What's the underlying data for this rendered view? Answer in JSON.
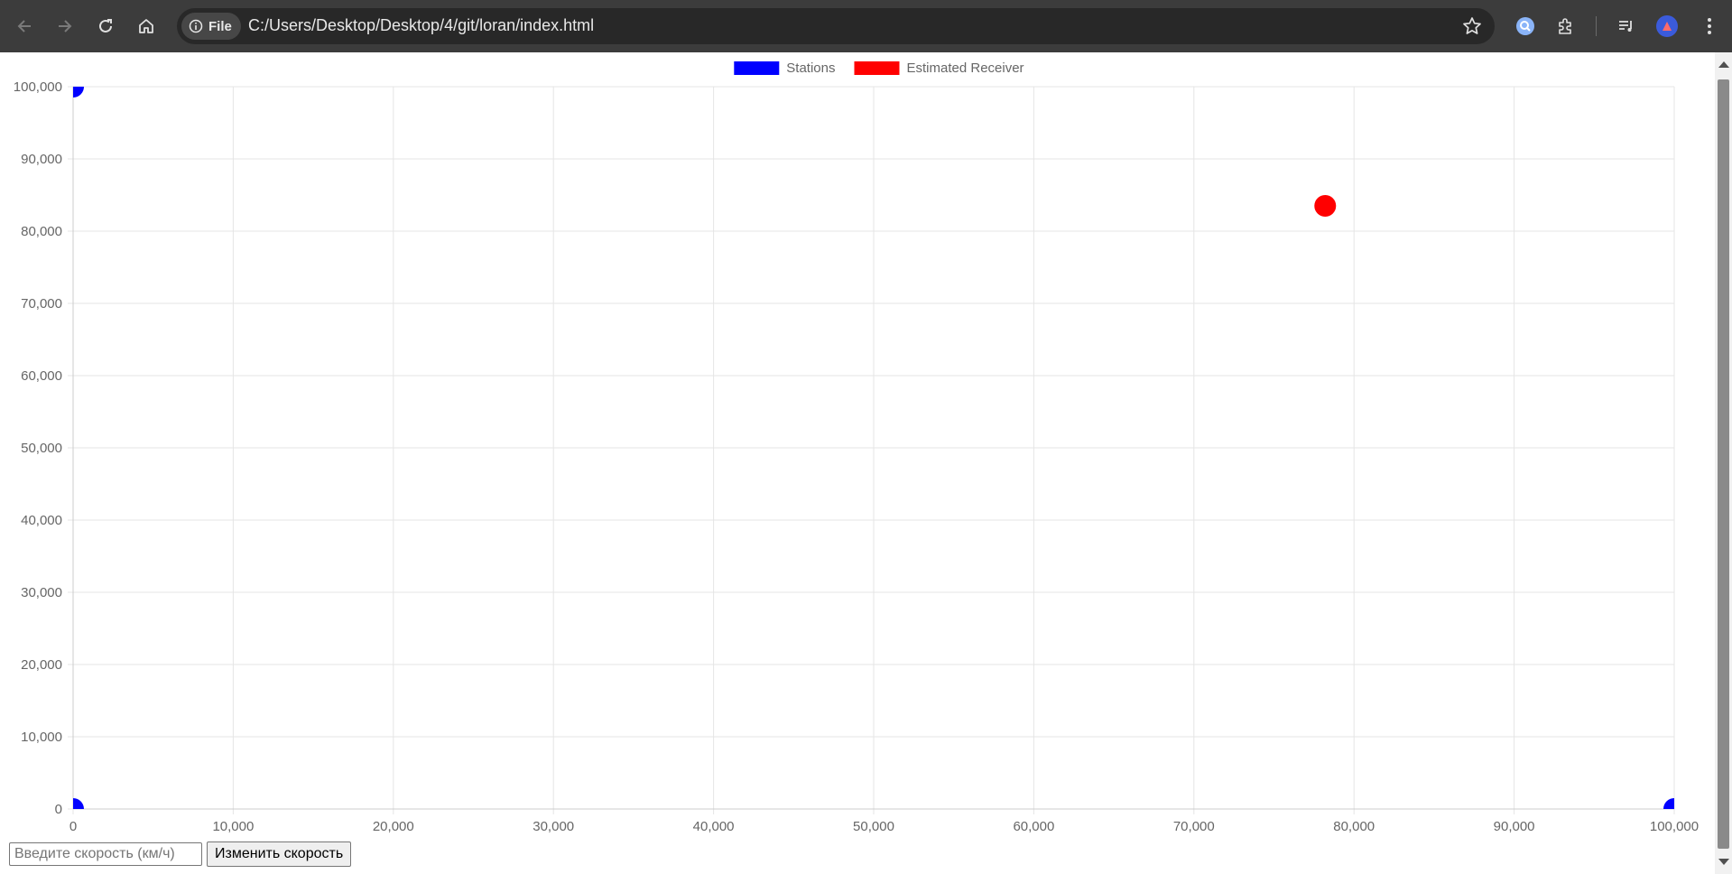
{
  "browser": {
    "scheme_chip": "File",
    "url": "C:/Users/Desktop/Desktop/4/git/loran/index.html"
  },
  "chart_data": {
    "type": "scatter",
    "xlim": [
      0,
      100000
    ],
    "ylim": [
      0,
      100000
    ],
    "x_ticks": [
      "0",
      "10,000",
      "20,000",
      "30,000",
      "40,000",
      "50,000",
      "60,000",
      "70,000",
      "80,000",
      "90,000",
      "100,000"
    ],
    "y_ticks": [
      "0",
      "10,000",
      "20,000",
      "30,000",
      "40,000",
      "50,000",
      "60,000",
      "70,000",
      "80,000",
      "90,000",
      "100,000"
    ],
    "grid": true,
    "legend_position": "top-center",
    "series": [
      {
        "name": "Stations",
        "color": "#0000ff",
        "points": [
          [
            0,
            0
          ],
          [
            100000,
            0
          ],
          [
            0,
            100000
          ]
        ]
      },
      {
        "name": "Estimated Receiver",
        "color": "#ff0000",
        "points": [
          [
            78200,
            83500
          ]
        ]
      }
    ]
  },
  "controls": {
    "speed_placeholder": "Введите скорость (км/ч)",
    "speed_value": "",
    "change_speed_label": "Изменить скорость"
  }
}
